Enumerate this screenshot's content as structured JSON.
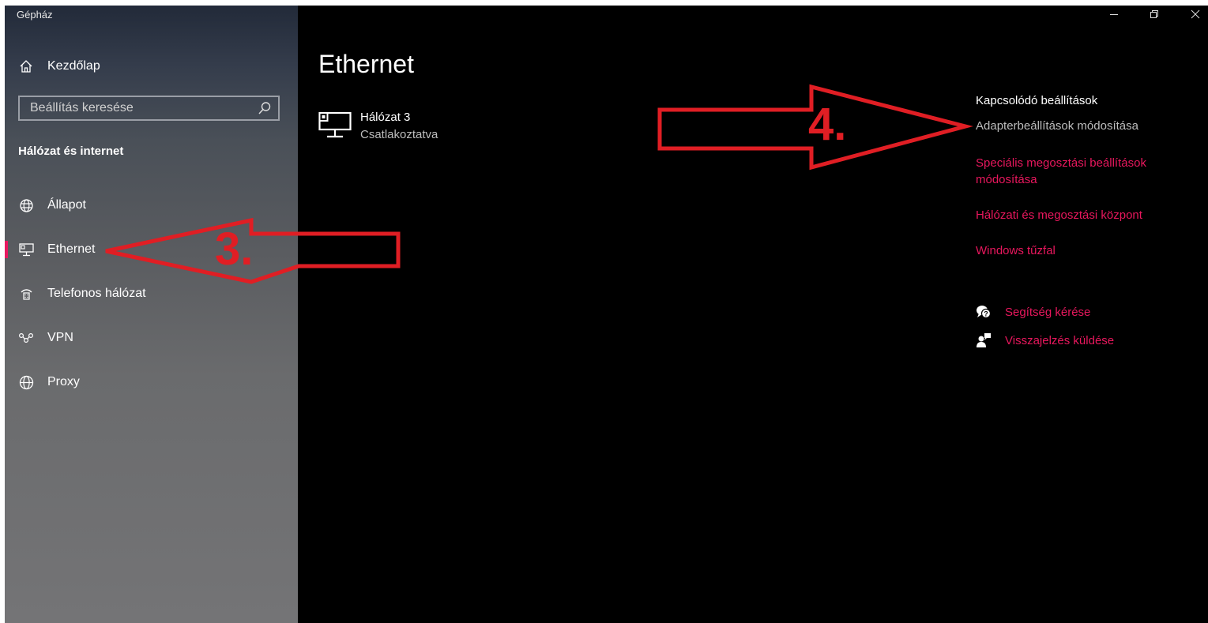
{
  "window": {
    "title": "Gépház"
  },
  "sidebar": {
    "home_label": "Kezdőlap",
    "search_placeholder": "Beállítás keresése",
    "section_title": "Hálózat és internet",
    "items": [
      {
        "label": "Állapot",
        "icon": "globe-status-icon"
      },
      {
        "label": "Ethernet",
        "icon": "ethernet-icon",
        "selected": true
      },
      {
        "label": "Telefonos hálózat",
        "icon": "dialup-icon"
      },
      {
        "label": "VPN",
        "icon": "vpn-icon"
      },
      {
        "label": "Proxy",
        "icon": "globe-icon"
      }
    ]
  },
  "main": {
    "title": "Ethernet",
    "network": {
      "name": "Hálózat 3",
      "status": "Csatlakoztatva"
    }
  },
  "related": {
    "header": "Kapcsolódó beállítások",
    "links": [
      "Adapterbeállítások módosítása",
      "Speciális megosztási beállítások",
      "módosítása",
      "Hálózati és megosztási központ",
      "Windows tűzfal"
    ],
    "help": "Segítség kérése",
    "feedback": "Visszajelzés küldése"
  },
  "annotations": {
    "arrow3": "3.",
    "arrow4": "4."
  },
  "colors": {
    "accent": "#e8175d",
    "annotation": "#e01e24",
    "background": "#000000"
  }
}
